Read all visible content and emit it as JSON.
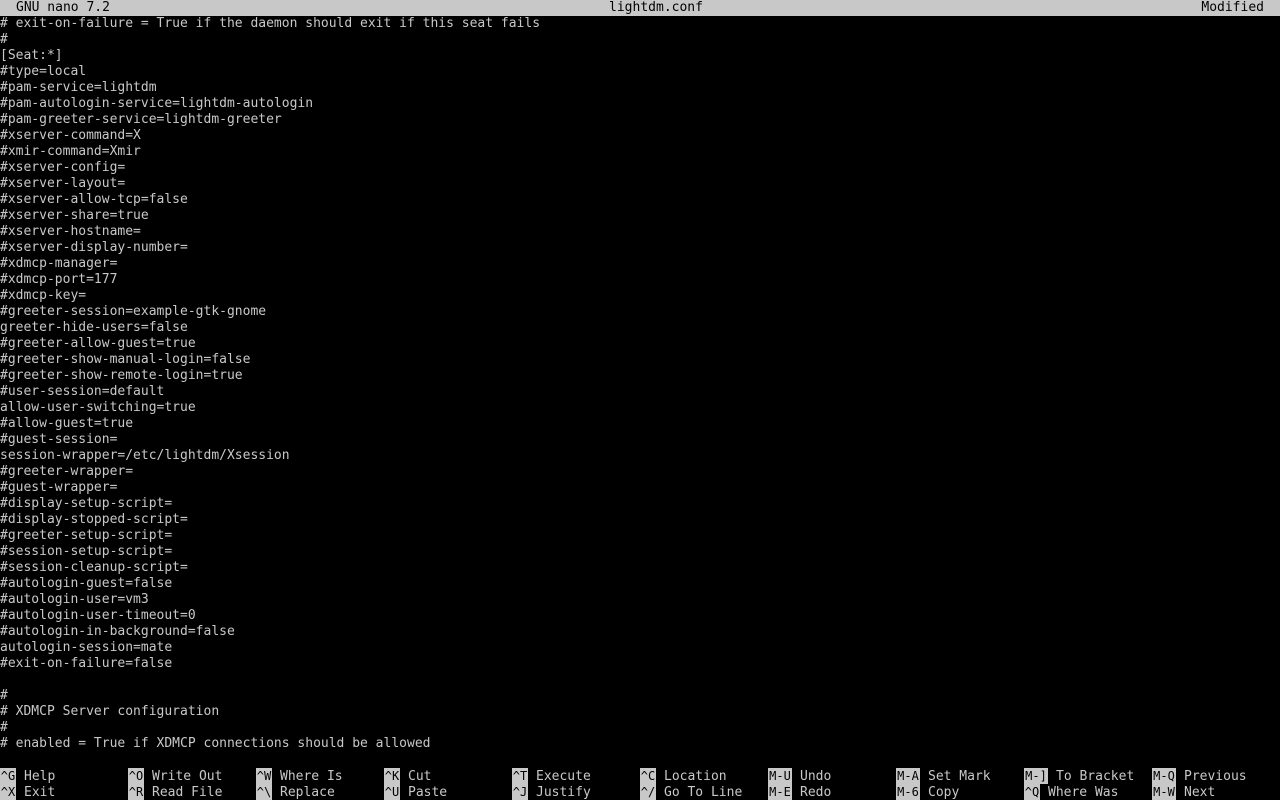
{
  "titlebar": {
    "app": "GNU nano 7.2",
    "filename": "lightdm.conf",
    "status": "Modified"
  },
  "editor": {
    "lines": [
      "# exit-on-failure = True if the daemon should exit if this seat fails",
      "#",
      "[Seat:*]",
      "#type=local",
      "#pam-service=lightdm",
      "#pam-autologin-service=lightdm-autologin",
      "#pam-greeter-service=lightdm-greeter",
      "#xserver-command=X",
      "#xmir-command=Xmir",
      "#xserver-config=",
      "#xserver-layout=",
      "#xserver-allow-tcp=false",
      "#xserver-share=true",
      "#xserver-hostname=",
      "#xserver-display-number=",
      "#xdmcp-manager=",
      "#xdmcp-port=177",
      "#xdmcp-key=",
      "#greeter-session=example-gtk-gnome",
      "greeter-hide-users=false",
      "#greeter-allow-guest=true",
      "#greeter-show-manual-login=false",
      "#greeter-show-remote-login=true",
      "#user-session=default",
      "allow-user-switching=true",
      "#allow-guest=true",
      "#guest-session=",
      "session-wrapper=/etc/lightdm/Xsession",
      "#greeter-wrapper=",
      "#guest-wrapper=",
      "#display-setup-script=",
      "#display-stopped-script=",
      "#greeter-setup-script=",
      "#session-setup-script=",
      "#session-cleanup-script=",
      "#autologin-guest=false",
      "#autologin-user=vm3",
      "#autologin-user-timeout=0",
      "#autologin-in-background=false",
      "autologin-session=mate",
      "#exit-on-failure=false",
      "",
      "#",
      "# XDMCP Server configuration",
      "#",
      "# enabled = True if XDMCP connections should be allowed"
    ]
  },
  "shortcuts": [
    {
      "key": "^G",
      "label": "Help"
    },
    {
      "key": "^X",
      "label": "Exit"
    },
    {
      "key": "^O",
      "label": "Write Out"
    },
    {
      "key": "^R",
      "label": "Read File"
    },
    {
      "key": "^W",
      "label": "Where Is"
    },
    {
      "key": "^\\",
      "label": "Replace"
    },
    {
      "key": "^K",
      "label": "Cut"
    },
    {
      "key": "^U",
      "label": "Paste"
    },
    {
      "key": "^T",
      "label": "Execute"
    },
    {
      "key": "^J",
      "label": "Justify"
    },
    {
      "key": "^C",
      "label": "Location"
    },
    {
      "key": "^/",
      "label": "Go To Line"
    },
    {
      "key": "M-U",
      "label": "Undo"
    },
    {
      "key": "M-E",
      "label": "Redo"
    },
    {
      "key": "M-A",
      "label": "Set Mark"
    },
    {
      "key": "M-6",
      "label": "Copy"
    },
    {
      "key": "M-]",
      "label": "To Bracket"
    },
    {
      "key": "^Q",
      "label": "Where Was"
    },
    {
      "key": "M-Q",
      "label": "Previous"
    },
    {
      "key": "M-W",
      "label": "Next"
    }
  ]
}
